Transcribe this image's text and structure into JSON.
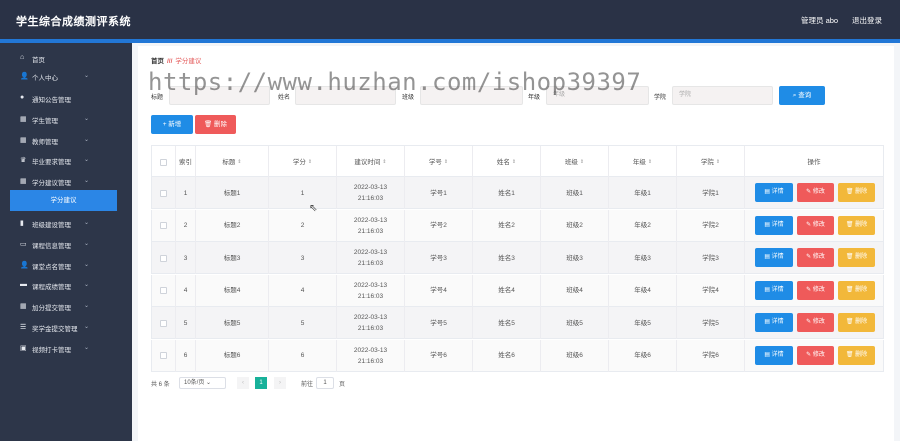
{
  "header": {
    "title": "学生综合成绩测评系统",
    "admin": "管理员 abo",
    "logout": "退出登录"
  },
  "sidebar": {
    "items": [
      {
        "icon": "home-icon",
        "glyph": "⌂",
        "label": "首页",
        "chev": ""
      },
      {
        "icon": "user-icon",
        "glyph": "👤",
        "label": "个人中心",
        "chev": "⌄"
      },
      {
        "icon": "location-icon",
        "glyph": "●",
        "label": "通知公告管理",
        "chev": ""
      },
      {
        "icon": "grid-icon",
        "glyph": "▦",
        "label": "学生管理",
        "chev": "⌄"
      },
      {
        "icon": "grid-icon",
        "glyph": "▦",
        "label": "教师管理",
        "chev": "⌄"
      },
      {
        "icon": "trophy-icon",
        "glyph": "♛",
        "label": "毕业要求管理",
        "chev": "⌄"
      },
      {
        "icon": "grid-icon",
        "glyph": "▦",
        "label": "学分建议管理",
        "chev": "⌄"
      },
      {
        "icon": "chart-icon",
        "glyph": "▮",
        "label": "班级建设管理",
        "chev": "⌄"
      },
      {
        "icon": "monitor-icon",
        "glyph": "▭",
        "label": "课程信息管理",
        "chev": "⌄"
      },
      {
        "icon": "person-icon",
        "glyph": "👤",
        "label": "课堂点名管理",
        "chev": "⌄"
      },
      {
        "icon": "book-icon",
        "glyph": "▬",
        "label": "课程成绩管理",
        "chev": "⌄"
      },
      {
        "icon": "grid-icon",
        "glyph": "▦",
        "label": "加分提交管理",
        "chev": "⌄"
      },
      {
        "icon": "list-icon",
        "glyph": "☰",
        "label": "奖学金提交管理",
        "chev": "⌄"
      },
      {
        "icon": "stamp-icon",
        "glyph": "▣",
        "label": "视频打卡管理",
        "chev": "⌄"
      }
    ],
    "submenu_active": "学分建议"
  },
  "breadcrumb": {
    "home": "首页",
    "sep": "///",
    "current": "学分建议"
  },
  "watermark": "https://www.huzhan.com/ishop39397",
  "search": {
    "fields": [
      {
        "label": "标题",
        "placeholder": ""
      },
      {
        "label": "姓名",
        "placeholder": ""
      },
      {
        "label": "班级",
        "placeholder": ""
      },
      {
        "label": "年级",
        "placeholder": "年级"
      },
      {
        "label": "学院",
        "placeholder": "学院"
      }
    ],
    "query": "查询"
  },
  "toolbar": {
    "add": "新增",
    "delete": "删除"
  },
  "table": {
    "headers": {
      "index": "索引",
      "title": "标题",
      "credit": "学分",
      "time": "建议时间",
      "sid": "学号",
      "name": "姓名",
      "class": "班级",
      "grade": "年级",
      "college": "学院",
      "ops": "操作"
    },
    "sort": "⇕",
    "rows": [
      {
        "index": "1",
        "title": "标题1",
        "credit": "1",
        "time": "2022-03-13 21:16:03",
        "sid": "学号1",
        "name": "姓名1",
        "class": "班级1",
        "grade": "年级1",
        "college": "学院1"
      },
      {
        "index": "2",
        "title": "标题2",
        "credit": "2",
        "time": "2022-03-13 21:16:03",
        "sid": "学号2",
        "name": "姓名2",
        "class": "班级2",
        "grade": "年级2",
        "college": "学院2"
      },
      {
        "index": "3",
        "title": "标题3",
        "credit": "3",
        "time": "2022-03-13 21:16:03",
        "sid": "学号3",
        "name": "姓名3",
        "class": "班级3",
        "grade": "年级3",
        "college": "学院3"
      },
      {
        "index": "4",
        "title": "标题4",
        "credit": "4",
        "time": "2022-03-13 21:16:03",
        "sid": "学号4",
        "name": "姓名4",
        "class": "班级4",
        "grade": "年级4",
        "college": "学院4"
      },
      {
        "index": "5",
        "title": "标题5",
        "credit": "5",
        "time": "2022-03-13 21:16:03",
        "sid": "学号5",
        "name": "姓名5",
        "class": "班级5",
        "grade": "年级5",
        "college": "学院5"
      },
      {
        "index": "6",
        "title": "标题6",
        "credit": "6",
        "time": "2022-03-13 21:16:03",
        "sid": "学号6",
        "name": "姓名6",
        "class": "班级6",
        "grade": "年级6",
        "college": "学院6"
      }
    ],
    "actions": {
      "detail": "详情",
      "edit": "修改",
      "remove": "删除"
    }
  },
  "pager": {
    "total": "共 6 条",
    "size": "10条/页",
    "prev": "‹",
    "page": "1",
    "next": "›",
    "goto": "前往",
    "goto_value": "1",
    "unit": "页"
  },
  "colors": {
    "topbar": "#2a3246",
    "sidebar": "#2d3649",
    "primary": "#1f8ce6",
    "danger": "#ef5a5a",
    "warning": "#f2b83a",
    "page_active": "#18b19a"
  }
}
